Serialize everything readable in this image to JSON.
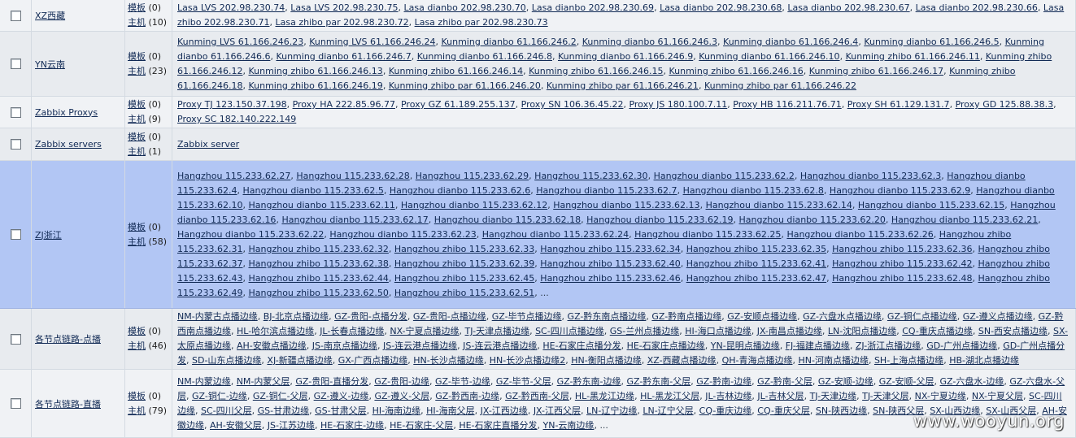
{
  "groups": [
    {
      "name": "XZ西藏",
      "templates_label": "模板",
      "templates_count": "(0)",
      "hosts_label": "主机",
      "hosts_count": "(10)",
      "selected": false,
      "hosts": [
        "Lasa LVS 202.98.230.74",
        "Lasa LVS 202.98.230.75",
        "Lasa dianbo 202.98.230.70",
        "Lasa dianbo 202.98.230.69",
        "Lasa dianbo 202.98.230.68",
        "Lasa dianbo 202.98.230.67",
        "Lasa dianbo 202.98.230.66",
        "Lasa zhibo 202.98.230.71",
        "Lasa zhibo par 202.98.230.72",
        "Lasa zhibo par 202.98.230.73"
      ]
    },
    {
      "name": "YN云南",
      "templates_label": "模板",
      "templates_count": "(0)",
      "hosts_label": "主机",
      "hosts_count": "(23)",
      "selected": false,
      "hosts": [
        "Kunming LVS 61.166.246.23",
        "Kunming LVS 61.166.246.24",
        "Kunming dianbo 61.166.246.2",
        "Kunming dianbo 61.166.246.3",
        "Kunming dianbo 61.166.246.4",
        "Kunming dianbo 61.166.246.5",
        "Kunming dianbo 61.166.246.6",
        "Kunming dianbo 61.166.246.7",
        "Kunming dianbo 61.166.246.8",
        "Kunming dianbo 61.166.246.9",
        "Kunming dianbo 61.166.246.10",
        "Kunming zhibo 61.166.246.11",
        "Kunming zhibo 61.166.246.12",
        "Kunming zhibo 61.166.246.13",
        "Kunming zhibo 61.166.246.14",
        "Kunming zhibo 61.166.246.15",
        "Kunming zhibo 61.166.246.16",
        "Kunming zhibo 61.166.246.17",
        "Kunming zhibo 61.166.246.18",
        "Kunming zhibo 61.166.246.19",
        "Kunming zhibo par 61.166.246.20",
        "Kunming zhibo par 61.166.246.21",
        "Kunming zhibo par 61.166.246.22"
      ]
    },
    {
      "name": "Zabbix Proxys",
      "templates_label": "模板",
      "templates_count": "(0)",
      "hosts_label": "主机",
      "hosts_count": "(9)",
      "selected": false,
      "hosts": [
        "Proxy TJ 123.150.37.198",
        "Proxy HA 222.85.96.77",
        "Proxy GZ 61.189.255.137",
        "Proxy SN 106.36.45.22",
        "Proxy JS 180.100.7.11",
        "Proxy HB 116.211.76.71",
        "Proxy SH 61.129.131.7",
        "Proxy GD 125.88.38.3",
        "Proxy SC 182.140.222.149"
      ]
    },
    {
      "name": "Zabbix servers",
      "templates_label": "模板",
      "templates_count": "(0)",
      "hosts_label": "主机",
      "hosts_count": "(1)",
      "selected": false,
      "hosts": [
        "Zabbix server"
      ]
    },
    {
      "name": "ZJ浙江",
      "templates_label": "模板",
      "templates_count": "(0)",
      "hosts_label": "主机",
      "hosts_count": "(58)",
      "selected": true,
      "hosts": [
        "Hangzhou 115.233.62.27",
        "Hangzhou 115.233.62.28",
        "Hangzhou 115.233.62.29",
        "Hangzhou 115.233.62.30",
        "Hangzhou dianbo 115.233.62.2",
        "Hangzhou dianbo 115.233.62.3",
        "Hangzhou dianbo 115.233.62.4",
        "Hangzhou dianbo 115.233.62.5",
        "Hangzhou dianbo 115.233.62.6",
        "Hangzhou dianbo 115.233.62.7",
        "Hangzhou dianbo 115.233.62.8",
        "Hangzhou dianbo 115.233.62.9",
        "Hangzhou dianbo 115.233.62.10",
        "Hangzhou dianbo 115.233.62.11",
        "Hangzhou dianbo 115.233.62.12",
        "Hangzhou dianbo 115.233.62.13",
        "Hangzhou dianbo 115.233.62.14",
        "Hangzhou dianbo 115.233.62.15",
        "Hangzhou dianbo 115.233.62.16",
        "Hangzhou dianbo 115.233.62.17",
        "Hangzhou dianbo 115.233.62.18",
        "Hangzhou dianbo 115.233.62.19",
        "Hangzhou dianbo 115.233.62.20",
        "Hangzhou dianbo 115.233.62.21",
        "Hangzhou dianbo 115.233.62.22",
        "Hangzhou dianbo 115.233.62.23",
        "Hangzhou dianbo 115.233.62.24",
        "Hangzhou dianbo 115.233.62.25",
        "Hangzhou dianbo 115.233.62.26",
        "Hangzhou zhibo 115.233.62.31",
        "Hangzhou zhibo 115.233.62.32",
        "Hangzhou zhibo 115.233.62.33",
        "Hangzhou zhibo 115.233.62.34",
        "Hangzhou zhibo 115.233.62.35",
        "Hangzhou zhibo 115.233.62.36",
        "Hangzhou zhibo 115.233.62.37",
        "Hangzhou zhibo 115.233.62.38",
        "Hangzhou zhibo 115.233.62.39",
        "Hangzhou zhibo 115.233.62.40",
        "Hangzhou zhibo 115.233.62.41",
        "Hangzhou zhibo 115.233.62.42",
        "Hangzhou zhibo 115.233.62.43",
        "Hangzhou zhibo 115.233.62.44",
        "Hangzhou zhibo 115.233.62.45",
        "Hangzhou zhibo 115.233.62.46",
        "Hangzhou zhibo 115.233.62.47",
        "Hangzhou zhibo 115.233.62.48",
        "Hangzhou zhibo 115.233.62.49",
        "Hangzhou zhibo 115.233.62.50",
        "Hangzhou zhibo 115.233.62.51"
      ],
      "more": "..."
    },
    {
      "name": "各节点链路-点播",
      "templates_label": "模板",
      "templates_count": "(0)",
      "hosts_label": "主机",
      "hosts_count": "(46)",
      "selected": false,
      "hosts": [
        "NM-内蒙古点播边缘",
        "BJ-北京点播边缘",
        "GZ-贵阳-点播分发",
        "GZ-贵阳-点播边缘",
        "GZ-毕节点播边缘",
        "GZ-黔东南点播边缘",
        "GZ-黔南点播边缘",
        "GZ-安顺点播边缘",
        "GZ-六盘水点播边缘",
        "GZ-铜仁点播边缘",
        "GZ-遵义点播边缘",
        "GZ-黔西南点播边缘",
        "HL-哈尔滨点播边缘",
        "JL-长春点播边缘",
        "NX-宁夏点播边缘",
        "TJ-天津点播边缘",
        "SC-四川点播边缘",
        "GS-兰州点播边缘",
        "HI-海口点播边缘",
        "JX-南昌点播边缘",
        "LN-沈阳点播边缘",
        "CQ-重庆点播边缘",
        "SN-西安点播边缘",
        "SX-太原点播边缘",
        "AH-安徽点播边缘",
        "JS-南京点播边缘",
        "JS-连云港点播边缘",
        "JS-连云港点播边缘",
        "HE-石家庄点播分发",
        "HE-石家庄点播边缘",
        "YN-昆明点播边缘",
        "FJ-福建点播边缘",
        "ZJ-浙江点播边缘",
        "GD-广州点播边缘",
        "GD-广州点播分发",
        "SD-山东点播边缘",
        "XJ-新疆点播边缘",
        "GX-广西点播边缘",
        "HN-长沙点播边缘",
        "HN-长沙点播边缘2",
        "HN-衡阳点播边缘",
        "XZ-西藏点播边缘",
        "QH-青海点播边缘",
        "HN-河南点播边缘",
        "SH-上海点播边缘",
        "HB-湖北点播边缘"
      ]
    },
    {
      "name": "各节点链路-直播",
      "templates_label": "模板",
      "templates_count": "(0)",
      "hosts_label": "主机",
      "hosts_count": "(79)",
      "selected": false,
      "hosts": [
        "NM-内蒙边缘",
        "NM-内蒙父层",
        "GZ-贵阳-直播分发",
        "GZ-贵阳-边缘",
        "GZ-毕节-边缘",
        "GZ-毕节-父层",
        "GZ-黔东南-边缘",
        "GZ-黔东南-父层",
        "GZ-黔南-边缘",
        "GZ-黔南-父层",
        "GZ-安顺-边缘",
        "GZ-安顺-父层",
        "GZ-六盘水-边缘",
        "GZ-六盘水-父层",
        "GZ-铜仁-边缘",
        "GZ-铜仁-父层",
        "GZ-遵义-边缘",
        "GZ-遵义-父层",
        "GZ-黔西南-边缘",
        "GZ-黔西南-父层",
        "HL-黑龙江边缘",
        "HL-黑龙江父层",
        "JL-吉林边缘",
        "JL-吉林父层",
        "TJ-天津边缘",
        "TJ-天津父层",
        "NX-宁夏边缘",
        "NX-宁夏父层",
        "SC-四川边缘",
        "SC-四川父层",
        "GS-甘肃边缘",
        "GS-甘肃父层",
        "HI-海南边缘",
        "HI-海南父层",
        "JX-江西边缘",
        "JX-江西父层",
        "LN-辽宁边缘",
        "LN-辽宁父层",
        "CQ-重庆边缘",
        "CQ-重庆父层",
        "SN-陕西边缘",
        "SN-陕西父层",
        "SX-山西边缘",
        "SX-山西父层",
        "AH-安徽边缘",
        "AH-安徽父层",
        "JS-江苏边缘",
        "HE-石家庄-边缘",
        "HE-石家庄-父层",
        "HE-石家庄直播分发",
        "YN-云南边缘"
      ],
      "more": "..."
    }
  ],
  "watermark": "www.wooyun.org"
}
